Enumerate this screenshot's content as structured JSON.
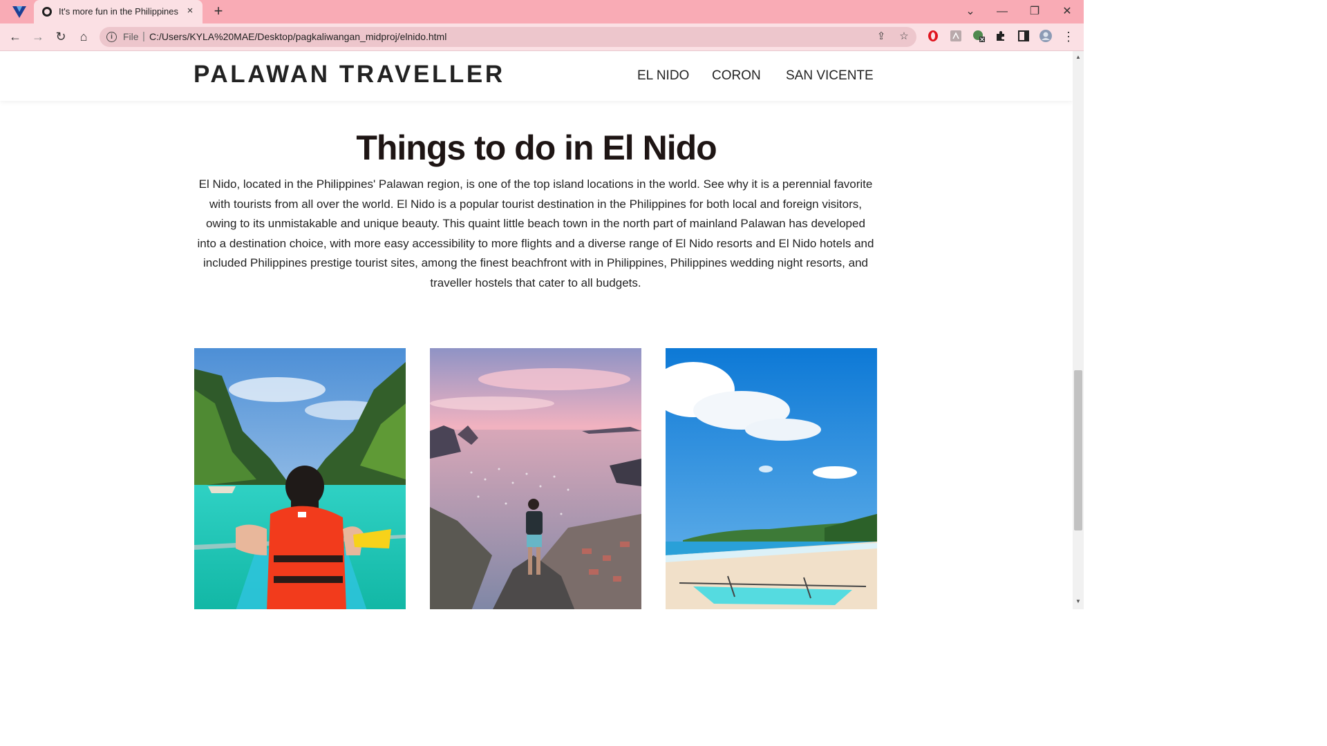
{
  "browser": {
    "tab_title": "It's more fun in the Philippines",
    "close_glyph": "×",
    "new_tab_glyph": "+",
    "url_scheme": "File",
    "url_separator": "|",
    "url": "C:/Users/KYLA%20MAE/Desktop/pagkaliwangan_midproj/elnido.html",
    "theme_color": "#f9abb5",
    "toolbar_color": "#fbe0e4",
    "icons": {
      "back": "←",
      "forward": "→",
      "reload": "↻",
      "home": "⌂",
      "share": "⇪",
      "star": "☆",
      "menu": "⋮",
      "minimize": "—",
      "restore": "❐",
      "close": "✕",
      "tab_search": "⌄"
    }
  },
  "site": {
    "brand": "PALAWAN TRAVELLER",
    "nav": [
      {
        "label": "EL NIDO"
      },
      {
        "label": "CORON"
      },
      {
        "label": "SAN VICENTE"
      }
    ],
    "title": "Things to do in El Nido",
    "intro": "El Nido, located in the Philippines' Palawan region, is one of the top island locations in the world. See why it is a perennial favorite with tourists from all over the world. El Nido is a popular tourist destination in the Philippines for both local and foreign visitors, owing to its unmistakable and unique beauty. This quaint little beach town in the north part of mainland Palawan has developed into a destination choice, with more easy accessibility to more flights and a diverse range of El Nido resorts and El Nido hotels and included Philippines prestige tourist sites, among the finest beachfront with in Philippines, Philippines wedding night resorts, and traveller hostels that cater to all budgets.",
    "photos": [
      {
        "subject": "kayak-lagoon"
      },
      {
        "subject": "sunset-viewpoint"
      },
      {
        "subject": "beach-boat"
      }
    ]
  }
}
